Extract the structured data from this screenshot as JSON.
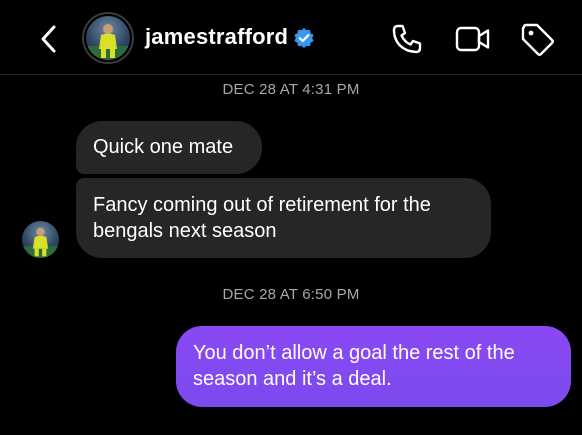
{
  "header": {
    "username": "jamestrafford",
    "verified": true,
    "icons": [
      "back-arrow-icon",
      "phone-icon",
      "video-call-icon",
      "tag-icon"
    ]
  },
  "thread": {
    "timestamp_1": "DEC 28 AT 4:31 PM",
    "timestamp_2": "DEC 28 AT 6:50 PM",
    "incoming": [
      "Quick one mate",
      [
        "Fancy coming out of retirement for the",
        "bengals next season"
      ]
    ],
    "outgoing": [
      [
        "You don’t allow a goal the rest of the",
        "season and it’s a deal."
      ]
    ]
  },
  "colors": {
    "background": "#000000",
    "incoming_bubble": "#262626",
    "outgoing_bubble": "#7b4bf0",
    "verified_badge": "#3897f0",
    "timestamp_text": "#a8a8a8"
  }
}
